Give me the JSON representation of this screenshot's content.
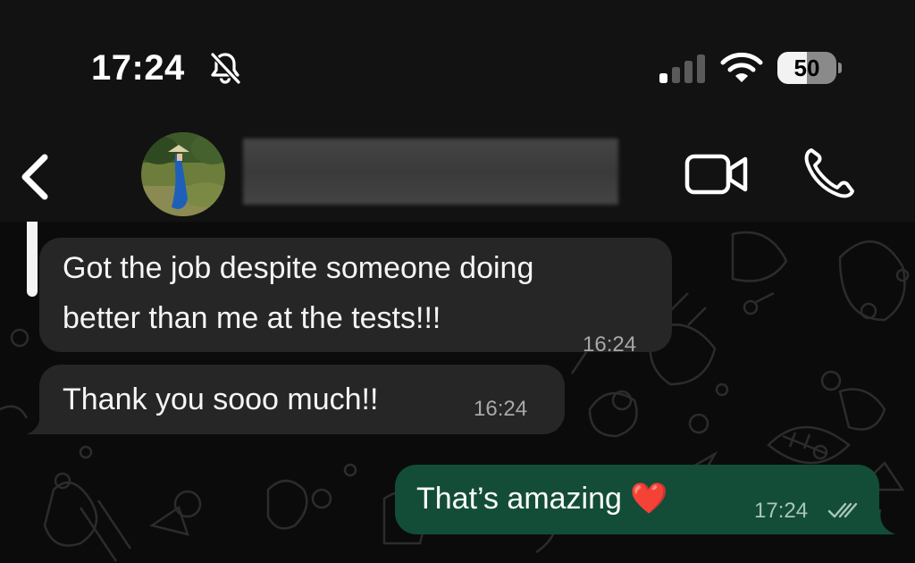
{
  "status_bar": {
    "time": "17:24",
    "battery": "50",
    "icons": [
      "bell-slash-icon",
      "cellular-signal-icon",
      "wifi-icon",
      "battery-icon"
    ]
  },
  "header": {
    "icons": [
      "chevron-left-icon",
      "video-call-icon",
      "phone-icon"
    ]
  },
  "messages": [
    {
      "direction": "incoming",
      "lines": [
        "Got the job despite someone doing",
        "better than me at the tests!!!"
      ],
      "time": "16:24"
    },
    {
      "direction": "incoming",
      "text": "Thank you sooo much!!",
      "time": "16:24"
    },
    {
      "direction": "outgoing",
      "text": "That’s amazing ❤️",
      "time": "17:24",
      "status": "double-check-icon"
    }
  ],
  "colors": {
    "background": "#0b0b0b",
    "bar": "#121212",
    "incoming_bubble": "#262626",
    "outgoing_bubble": "#134d37"
  }
}
